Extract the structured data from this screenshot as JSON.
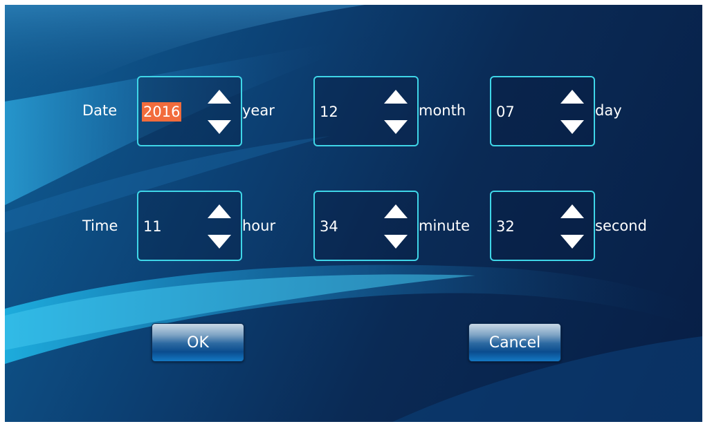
{
  "date_row": {
    "label": "Date",
    "fields": [
      {
        "value": "2016",
        "unit": "year",
        "selected": true
      },
      {
        "value": "12",
        "unit": "month",
        "selected": false
      },
      {
        "value": "07",
        "unit": "day",
        "selected": false
      }
    ]
  },
  "time_row": {
    "label": "Time",
    "fields": [
      {
        "value": "11",
        "unit": "hour",
        "selected": false
      },
      {
        "value": "34",
        "unit": "minute",
        "selected": false
      },
      {
        "value": "32",
        "unit": "second",
        "selected": false
      }
    ]
  },
  "buttons": {
    "ok_label": "OK",
    "cancel_label": "Cancel"
  },
  "colors": {
    "field_border": "#3fd6e8",
    "selection_highlight": "#f26c3c",
    "background": "#0a2a55"
  },
  "icons": {
    "increment": "triangle-up-icon",
    "decrement": "triangle-down-icon"
  }
}
